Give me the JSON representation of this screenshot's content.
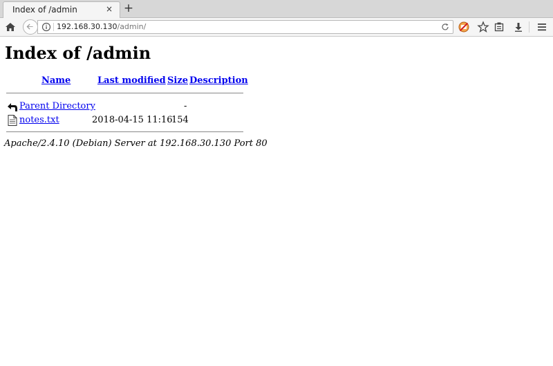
{
  "browser": {
    "tab_title": "Index of /admin",
    "tab_close": "×",
    "new_tab": "+",
    "url_host": "192.168.30.130",
    "url_path": "/admin/"
  },
  "page": {
    "title": "Index of /admin",
    "columns": {
      "name": "Name",
      "last_modified": "Last modified",
      "size": "Size",
      "description": "Description"
    },
    "rows": [
      {
        "icon": "back-icon",
        "name": "Parent Directory",
        "modified": "",
        "size": "-",
        "description": ""
      },
      {
        "icon": "text-file-icon",
        "name": "notes.txt",
        "modified": "2018-04-15 11:16",
        "size": "154",
        "description": ""
      }
    ],
    "footer": "Apache/2.4.10 (Debian) Server at 192.168.30.130 Port 80"
  }
}
